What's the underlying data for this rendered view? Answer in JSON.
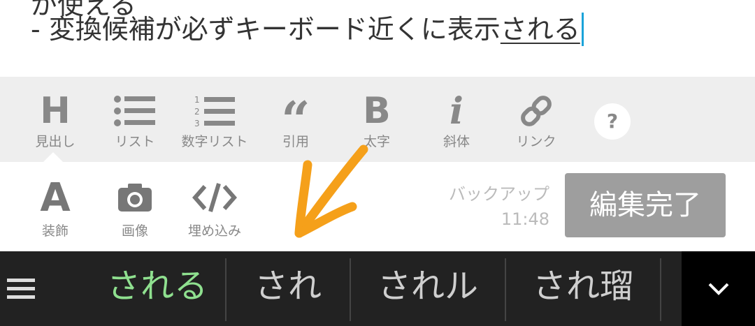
{
  "editor": {
    "line_clipped": "が使える",
    "line_prefix": "- 変換候補が必ずキーボード近くに表示",
    "composing": "される"
  },
  "format_toolbar": {
    "heading_label": "見出し",
    "list_label": "リスト",
    "numbered_list_label": "数字リスト",
    "quote_label": "引用",
    "bold_label": "太字",
    "italic_label": "斜体",
    "link_label": "リンク",
    "help_symbol": "?"
  },
  "bottom_toolbar": {
    "decoration_label": "装飾",
    "image_label": "画像",
    "embed_label": "埋め込み",
    "backup_label": "バックアップ",
    "backup_time": "11:48",
    "done_label": "編集完了"
  },
  "ime": {
    "candidates": [
      "される",
      "され",
      "されル",
      "され瑠"
    ]
  },
  "colors": {
    "accent_caret": "#1aa3d9",
    "annotation_arrow": "#f5a01a",
    "active_candidate": "#8fe08f"
  }
}
